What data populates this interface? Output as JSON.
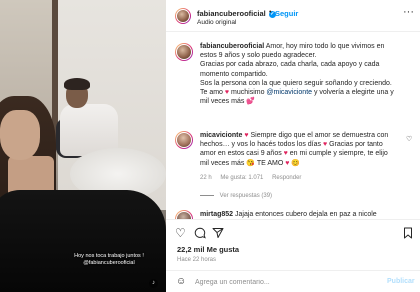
{
  "post": {
    "caption_overlay_line1": "Hoy nos toca trabajo juntos !",
    "caption_overlay_line2": "@fabiancuberooficial"
  },
  "header": {
    "username": "fabiancuberooficial",
    "verified_icon": "verified-badge-icon",
    "separator": "•",
    "follow_label": "Seguir",
    "subtitle": "Audio original",
    "more_label": "···"
  },
  "comments": [
    {
      "username": "fabiancuberooficial",
      "text_parts": [
        "Amor, hoy miro todo lo que vivimos en",
        "estos 9 años y solo puedo agradecer.",
        "Gracias por cada abrazo, cada charla, cada apoyo y cada",
        "momento compartido.",
        "Sos la persona con la que quiero seguir soñando y creciendo.",
        "Te amo",
        " muchisimo ",
        "@micavicionte",
        " y volvería a elegirte una y",
        "mil veces más"
      ],
      "heart_glyph": "♥"
    },
    {
      "username": "micavicionte",
      "text_parts": [
        "Siempre digo que el amor se demuestra con",
        "hechos… y vos lo hacés todos los días",
        " Gracias por tanto",
        "amor en estos casi 9 años",
        " en mi cumple y siempre, te elijo",
        "mil veces más",
        " TE AMO"
      ],
      "age": "22 h",
      "likes": "Me gusta: 1.071",
      "reply": "Responder",
      "view_replies": "Ver respuestas (39)"
    },
    {
      "username": "mirtag852",
      "text": "Jajaja entonces cubero dejala en paz a nicole"
    }
  ],
  "actions": {
    "likes_count": "22,2 mil Me gusta",
    "timestamp": "Hace 22 horas"
  },
  "composer": {
    "emoji_icon": "smiley-icon",
    "placeholder": "Agrega un comentario...",
    "publish_label": "Publicar"
  },
  "colors": {
    "accent_blue": "#0095f6",
    "mention_blue": "#00376b",
    "heart_red": "#e0245e",
    "muted_gray": "#8e8e8e",
    "publish_disabled": "#b2dffc"
  }
}
